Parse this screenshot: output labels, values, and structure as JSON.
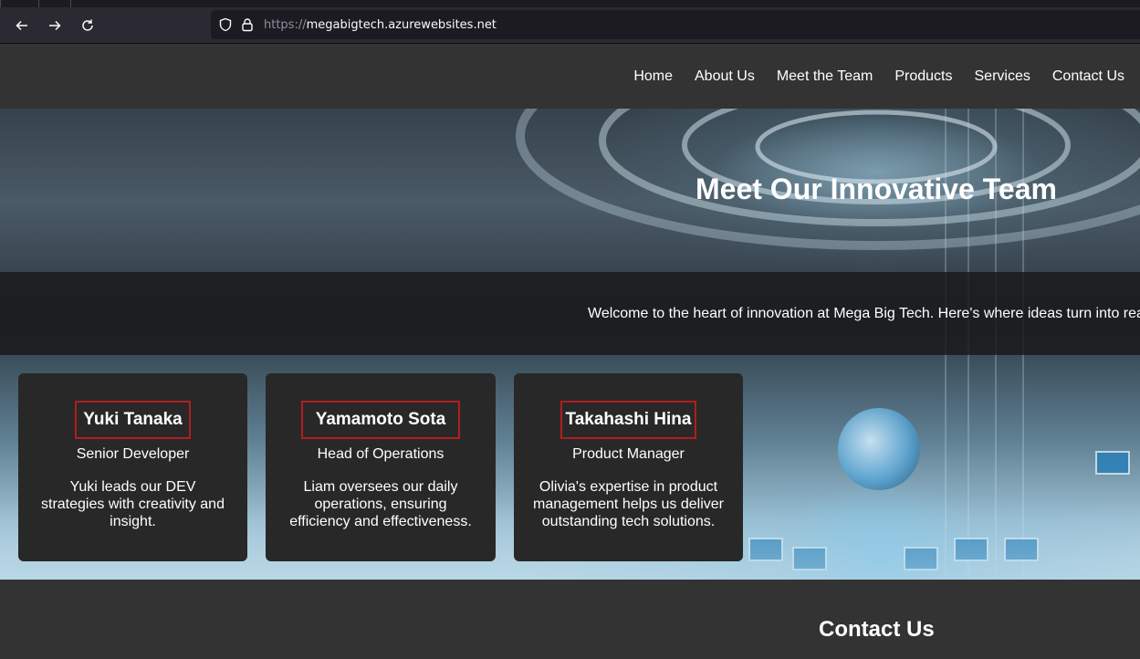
{
  "browser": {
    "url_protocol": "https://",
    "url_host": "megabigtech.azurewebsites.net",
    "icons": [
      "back-arrow-icon",
      "forward-arrow-icon",
      "reload-icon",
      "shield-icon",
      "lock-icon"
    ]
  },
  "nav": {
    "items": [
      {
        "label": "Home"
      },
      {
        "label": "About Us"
      },
      {
        "label": "Meet the Team"
      },
      {
        "label": "Products"
      },
      {
        "label": "Services"
      },
      {
        "label": "Contact Us"
      }
    ]
  },
  "hero": {
    "title": "Meet Our Innovative Team",
    "welcome": "Welcome to the heart of innovation at Mega Big Tech. Here's where ideas turn into rea"
  },
  "team": [
    {
      "name": "Yuki Tanaka",
      "role": "Senior Developer",
      "description": "Yuki leads our DEV strategies with creativity and insight."
    },
    {
      "name": "Yamamoto Sota",
      "role": "Head of Operations",
      "description": "Liam oversees our daily operations, ensuring efficiency and effectiveness."
    },
    {
      "name": "Takahashi Hina",
      "role": "Product Manager",
      "description": "Olivia's expertise in product management helps us deliver outstanding tech solutions."
    }
  ],
  "contact": {
    "title": "Contact Us"
  },
  "colors": {
    "header_bg": "#333333",
    "card_bg": "#282828",
    "name_border": "#b01e1e",
    "browser_toolbar": "#2b2a33"
  }
}
